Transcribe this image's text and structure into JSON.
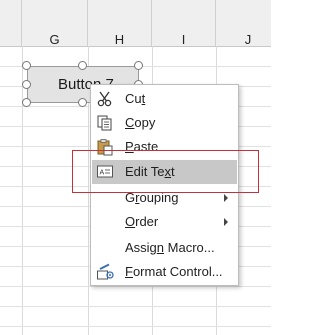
{
  "sheet": {
    "columns": [
      "G",
      "H",
      "I",
      "J"
    ]
  },
  "form_button": {
    "label": "Button 7"
  },
  "context_menu": {
    "items": [
      {
        "label_pre": "Cu",
        "label_u": "t",
        "label_post": "",
        "icon": "scissors-icon"
      },
      {
        "label_pre": "",
        "label_u": "C",
        "label_post": "opy",
        "icon": "copy-icon"
      },
      {
        "label_pre": "",
        "label_u": "P",
        "label_post": "aste",
        "icon": "paste-icon"
      },
      {
        "label_pre": "Edit Te",
        "label_u": "x",
        "label_post": "t",
        "icon": "edit-text-icon"
      },
      {
        "label_pre": "G",
        "label_u": "r",
        "label_post": "ouping",
        "has_submenu": true
      },
      {
        "label_pre": "",
        "label_u": "O",
        "label_post": "rder",
        "has_submenu": true
      },
      {
        "label_pre": "Assig",
        "label_u": "n",
        "label_post": " Macro...",
        "icon": ""
      },
      {
        "label_pre": "",
        "label_u": "F",
        "label_post": "ormat Control...",
        "icon": "format-control-icon"
      }
    ],
    "highlighted_item": "Edit Text"
  },
  "colors": {
    "header_bg": "#efefef",
    "menu_highlight": "#c8c8c8",
    "annotation_box": "#c0333a"
  }
}
